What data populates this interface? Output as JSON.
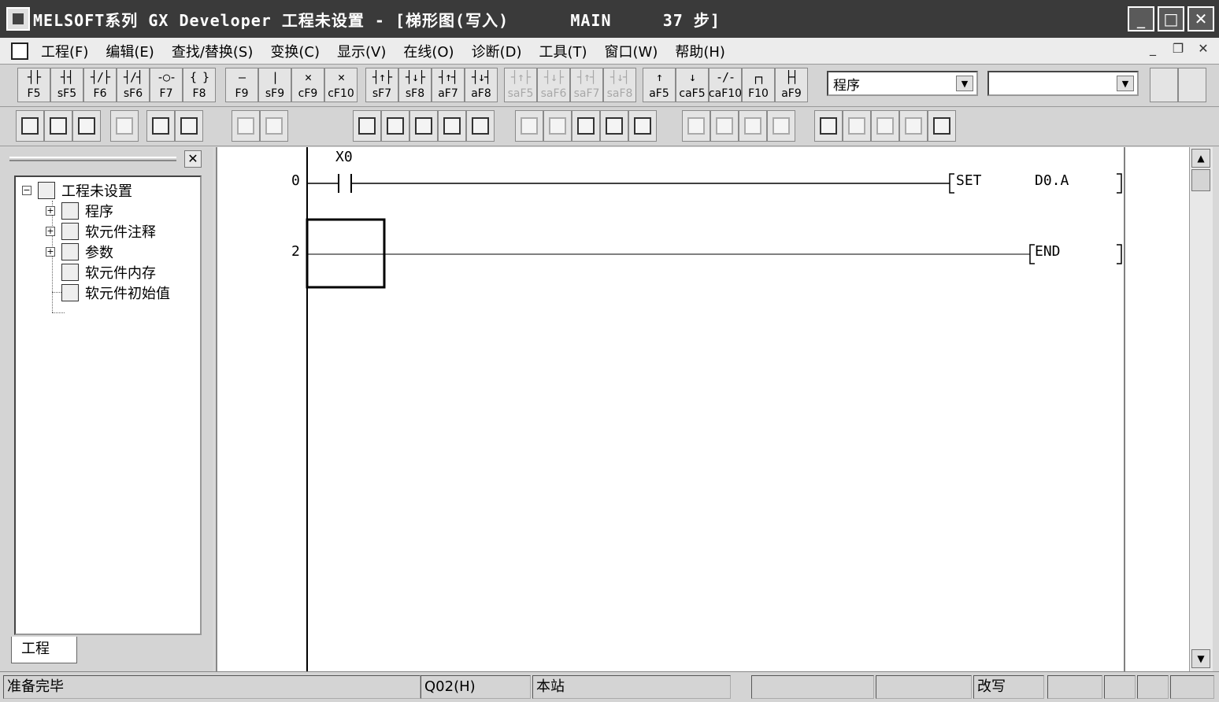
{
  "window": {
    "title": "MELSOFT系列 GX Developer 工程未设置 - [梯形图(写入)      MAIN     37 步]",
    "controls": {
      "minimize": "_",
      "maximize": "□",
      "close": "✕"
    }
  },
  "menu": {
    "items": [
      "工程(F)",
      "编辑(E)",
      "查找/替换(S)",
      "变换(C)",
      "显示(V)",
      "在线(O)",
      "诊断(D)",
      "工具(T)",
      "窗口(W)",
      "帮助(H)"
    ],
    "mdi": {
      "minimize": "_",
      "restore": "❐",
      "close": "✕"
    }
  },
  "toolbar1": {
    "group1": [
      {
        "sym": "┤├",
        "key": "F5"
      },
      {
        "sym": "┤┤",
        "key": "sF5"
      },
      {
        "sym": "┤/├",
        "key": "F6"
      },
      {
        "sym": "┤/┤",
        "key": "sF6"
      },
      {
        "sym": "-○-",
        "key": "F7"
      },
      {
        "sym": "{ }",
        "key": "F8"
      }
    ],
    "group2": [
      {
        "sym": "—",
        "key": "F9"
      },
      {
        "sym": "|",
        "key": "sF9"
      },
      {
        "sym": "✕",
        "key": "cF9"
      },
      {
        "sym": "✕",
        "key": "cF10"
      }
    ],
    "group3": [
      {
        "sym": "┤↑├",
        "key": "sF7"
      },
      {
        "sym": "┤↓├",
        "key": "sF8"
      },
      {
        "sym": "┤↑┤",
        "key": "aF7"
      },
      {
        "sym": "┤↓┤",
        "key": "aF8"
      }
    ],
    "group4": [
      {
        "sym": "┤↑├",
        "key": "saF5"
      },
      {
        "sym": "┤↓├",
        "key": "saF6"
      },
      {
        "sym": "┤↑┤",
        "key": "saF7"
      },
      {
        "sym": "┤↓┤",
        "key": "saF8"
      }
    ],
    "group5": [
      {
        "sym": "↑",
        "key": "aF5"
      },
      {
        "sym": "↓",
        "key": "caF5"
      },
      {
        "sym": "-/-",
        "key": "caF10"
      },
      {
        "sym": "┌┐",
        "key": "F10"
      },
      {
        "sym": "├┤",
        "key": "aF9"
      }
    ],
    "program_combo": "程序",
    "second_combo": ""
  },
  "tree": {
    "root": "工程未设置",
    "children": [
      "程序",
      "软元件注释",
      "参数",
      "软元件内存",
      "软元件初始值"
    ],
    "tab": "工程"
  },
  "ladder": {
    "rungs": [
      {
        "step": "0",
        "contact": "X0",
        "instr": "SET",
        "operand": "D0.A"
      },
      {
        "step": "2",
        "instr": "END"
      }
    ]
  },
  "status": {
    "message": "准备完毕",
    "cpu": "Q02(H)",
    "station": "本站",
    "mode": "改写"
  }
}
